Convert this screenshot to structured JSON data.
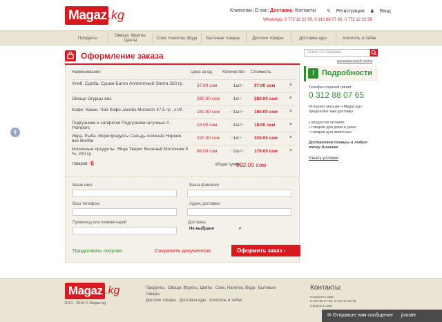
{
  "header": {
    "logo_text": "Magaz",
    "logo_suffix": ".kg",
    "nav": [
      "Клиентам",
      "О нас",
      "Доставка",
      "Контакты"
    ],
    "nav_active": "Доставка",
    "register": "Регистрация",
    "login": "Вход",
    "whatsapp": "WhatsApp: 0 772 12 22 95, 0 312 88 07 65, 0 772 12 22 95"
  },
  "categories": [
    "Продукты",
    "Овощи, Фрукты, Цветы",
    "Соки, Напитки, Вода",
    "Бытовые товары",
    "Детские товары",
    "Доставка еды",
    "Алкоголь и табак"
  ],
  "page": {
    "title": "Оформление заказа"
  },
  "search": {
    "placeholder": "поиск по товарам",
    "advanced": "расширенный поиск"
  },
  "cart": {
    "columns": {
      "name": "Наименование",
      "price": "Цена за ед.",
      "qty": "Количество",
      "cost": "Стоимость"
    },
    "items": [
      {
        "name": "Хлеб. Сдоба. Сушки Батон Аппетитный Элита 350 гр.",
        "price": "37.00 сом",
        "qty": "1шт",
        "cost": "37.00 сом"
      },
      {
        "name": "Овощи Огурцы вес",
        "price": "280.00 сом",
        "qty": "1кг",
        "cost": "280.00 сом"
      },
      {
        "name": "Кофе. Какао. Чай Кофе Jacobs Monarch 47,5 гр., ст/б",
        "price": "160.00 сом",
        "qty": "1шт",
        "cost": "160.00 сом"
      },
      {
        "name": "Подгузники и салфетки Подгузники штучные 4 - Pampers",
        "price": "19.00 сом",
        "qty": "1шт",
        "cost": "19.00 сом"
      },
      {
        "name": "Икра. Рыба. Морепродукты Сельдь соленая Норвеж вес Вилби",
        "price": "220.00 сом",
        "qty": "1кг",
        "cost": "220.00 сом"
      },
      {
        "name": "Молочные продукты. Яйца Творог Веселый Молочник 5 %, 200 гр",
        "price": "88.00 сом",
        "qty": "2шт",
        "cost": "176.00 сом"
      }
    ],
    "count_label": "товаров:",
    "count": "6",
    "sum_label": "общая сумма:",
    "sum": "892.00 сом",
    "delete_symbol": "×",
    "minus": "−",
    "plus": "+"
  },
  "form": {
    "name_label": "Ваше имя:",
    "surname_label": "Ваша фамилия",
    "phone_label": "Ваш телефон:",
    "address_label": "Адрес доставки:",
    "promo_label": "Промокод или комментарий",
    "delivery_label": "Доставка",
    "delivery_value": "Не выбрано",
    "continue": "Продолжить покупки",
    "save": "Сохранить документом",
    "submit": "Оформить заказ  ›"
  },
  "details": {
    "title": "Подробности",
    "hotline_label": "Телефон горячей линии:",
    "hotline": "0 312 88 07 65",
    "intro": "Интернет магазин «Magaz.kg» предлагает вам доставку:",
    "bullets": [
      "• продуктов питания;",
      "• товаров для дома и дачи;",
      "• товаров для животных;"
    ],
    "deliver": "Доставляем товары в любую точку Бишкека",
    "terms": "Узнать условия"
  },
  "footer": {
    "copyright": "2014 - 2015 © Magaz.kg",
    "nav": [
      "Продукты",
      "Овощи, Фрукты, Цветы",
      "Соки, Напитки, Вода",
      "Бытовые товары",
      "Детские товары",
      "Доставка еды",
      "Алкоголь и табак"
    ],
    "contacts_title": "Контакты:",
    "contacts_small1": "Позвонить нам:",
    "contacts_phones": "0 312 88 07 65,  0 772 12 22 95",
    "contacts_small2": "Написать нам:",
    "chat_text": "Отправьте нам сообщение",
    "chat_brand": "jivosite"
  },
  "colors": {
    "accent": "#d71920",
    "green": "#2f8f2f",
    "beige": "#e9e4d3"
  }
}
